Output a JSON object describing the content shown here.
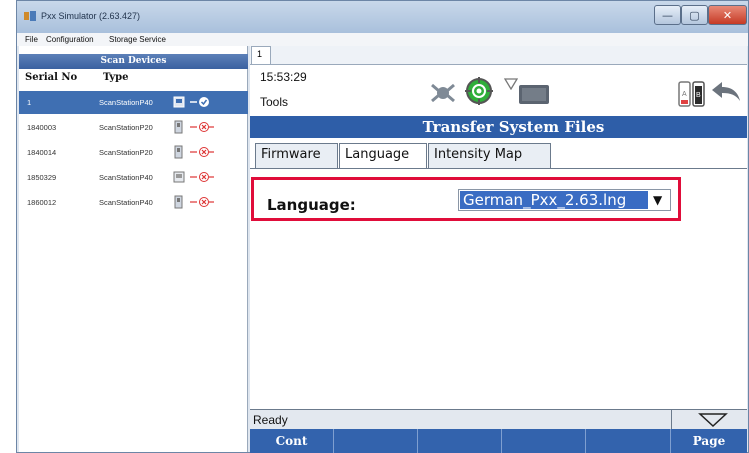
{
  "window": {
    "title": "Pxx Simulator (2.63.427)",
    "controls": {
      "minimize": "—",
      "maximize": "▢",
      "close": "✕"
    }
  },
  "menu": [
    "File",
    "Configuration",
    "Storage Service"
  ],
  "scan_devices": {
    "title": "Scan Devices",
    "columns": [
      "Serial No",
      "Type"
    ],
    "rows": [
      {
        "serial": "1",
        "type": "ScanStationP40",
        "selected": true
      },
      {
        "serial": "1840003",
        "type": "ScanStationP20",
        "selected": false
      },
      {
        "serial": "1840014",
        "type": "ScanStationP20",
        "selected": false
      },
      {
        "serial": "1850329",
        "type": "ScanStationP40",
        "selected": false
      },
      {
        "serial": "1860012",
        "type": "ScanStationP40",
        "selected": false
      }
    ]
  },
  "document_tab": "1",
  "device": {
    "time": "15:53:29",
    "mode": "Tools",
    "panel_title": "Transfer System Files",
    "tabs": [
      "Firmware",
      "Language",
      "Intensity Map"
    ],
    "active_tab": "Language",
    "language_label": "Language:",
    "language_value": "German_Pxx_2.63.lng",
    "status": "Ready",
    "softkeys": [
      "Cont",
      "",
      "",
      "",
      "",
      "Page"
    ]
  },
  "colors": {
    "accent": "#2e5ea8",
    "highlight": "#e00d3a",
    "selection": "#3a6cc3"
  }
}
